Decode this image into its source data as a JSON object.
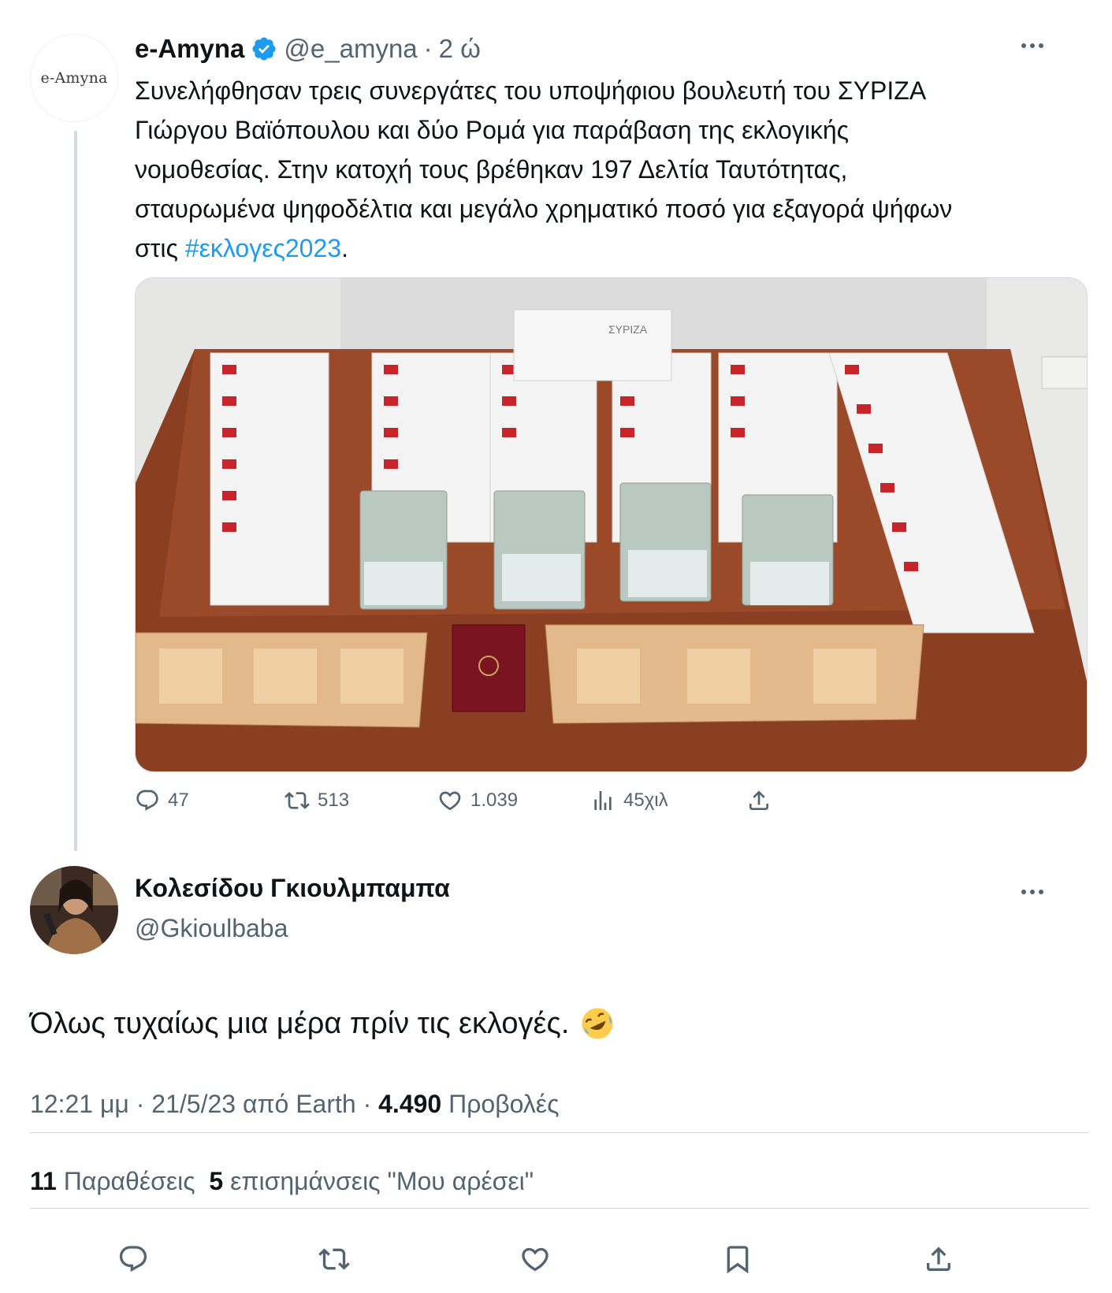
{
  "quoted": {
    "avatar_text": "e-Amyna",
    "name": "e-Amyna",
    "handle": "@e_amyna",
    "dot": "·",
    "time": "2 ώ",
    "text": "Συνελήφθησαν τρεις συνεργάτες του υποψήφιου βουλευτή του ΣΥΡΙΖΑ\nΓιώργου Βαϊόπουλου και δύο Ρομά για παράβαση της εκλογικής\nνομοθεσίας. Στην κατοχή τους βρέθηκαν 197 Δελτία Ταυτότητας,\nσταυρωμένα ψηφοδέλτια και μεγάλο χρηματικό ποσό για εξαγορά ψήφων\nστις ",
    "hashtag": "#εκλογες2023",
    "text_end": ".",
    "media_ballot_text": "ΣΥΡΙΖΑ",
    "actions": {
      "replies": "47",
      "retweets": "513",
      "likes": "1.039",
      "views": "45χιλ"
    }
  },
  "tweet": {
    "name": "Κολεσίδου Γκιουλμπαμπα",
    "handle": "@Gkioulbaba",
    "text": "Όλως τυχαίως μια μέρα πρίν τις εκλογές.",
    "time": "12:21 μμ",
    "sep1": " · ",
    "date": "21/5/23",
    "from_label": " από ",
    "source": "Earth",
    "sep2": " · ",
    "views_count": "4.490",
    "views_label": " Προβολές",
    "quotes_count": "11",
    "quotes_label": " Παραθέσεις",
    "likes_count": "5",
    "likes_label": " επισημάνσεις \"Μου αρέσει\""
  },
  "colors": {
    "accent": "#1d9bf0",
    "muted": "#536471",
    "text": "#0f1419",
    "divider": "#cfd9de"
  },
  "icons": [
    "verified-badge-icon",
    "more-icon",
    "reply-icon",
    "retweet-icon",
    "like-icon",
    "views-icon",
    "share-icon",
    "bookmark-icon",
    "rofl-emoji-icon"
  ]
}
